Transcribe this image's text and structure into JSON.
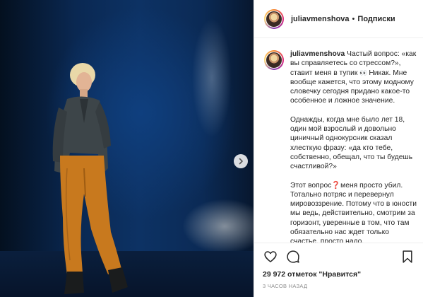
{
  "post": {
    "username": "juliavmenshova",
    "separator": "•",
    "follow_status": "Подписки"
  },
  "caption": {
    "username": "juliavmenshova",
    "p1_before_emoji": "Частый вопрос: «как вы справляетесь со стрессом?», ставит меня в тупик",
    "p1_emoji": "👀",
    "p1_after_emoji": "Никак. Мне вообще кажется, что этому модному словечку сегодня придано какое-то особенное и ложное значение.",
    "p2": "Однажды, когда мне было лет 18, один мой взрослый и довольно циничный однокурсник сказал хлесткую фразу: «да кто тебе, собственно, обещал, что ты будешь счастливой?»",
    "p3_before_emoji": "Этот вопрос",
    "p3_emoji": "❓",
    "p3_after_emoji": "меня просто убил. Тотально потряс и перевернул мировоззрение. Потому что в юности мы ведь, действительно, смотрим за горизонт, уверенные в том, что там обязательно нас ждет только счастье. просто надо."
  },
  "actions": {
    "icons": [
      "heart-icon",
      "comment-icon",
      "bookmark-icon"
    ],
    "likes": "29 972 отметок \"Нравится\"",
    "timestamp": "3 ЧАСОВ НАЗАД"
  },
  "colors": {
    "background": "#ffffff",
    "text": "#262626",
    "muted": "#8e8e8e",
    "divider": "#efefef",
    "photo_blue": "#0d3264",
    "trousers": "#c8791e"
  }
}
